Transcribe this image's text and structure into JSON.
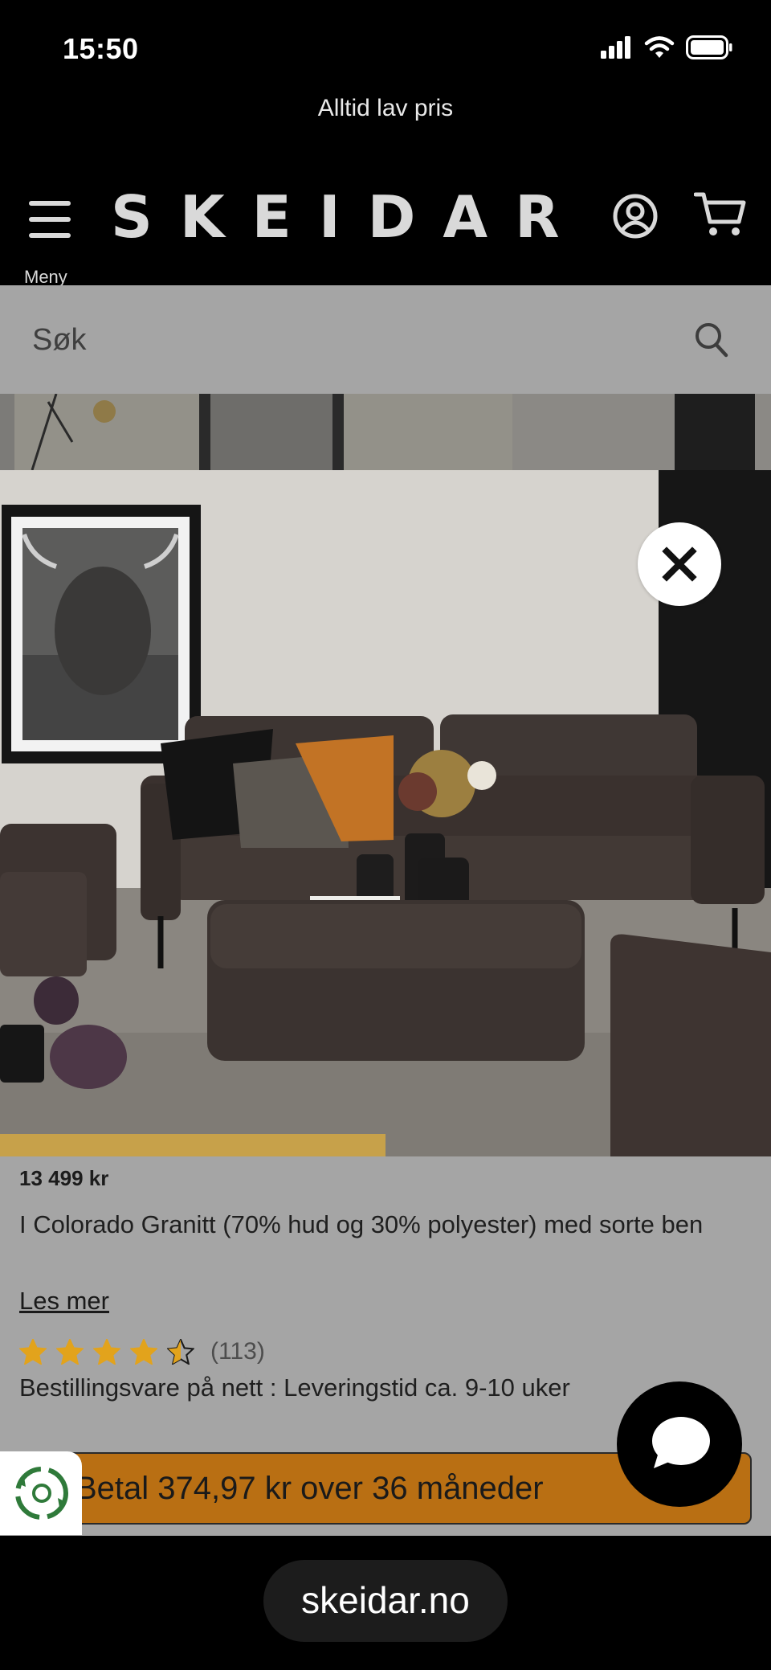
{
  "status": {
    "time": "15:50"
  },
  "promo": {
    "text": "Alltid lav pris"
  },
  "header": {
    "brand": "SKEIDAR",
    "menu_label": "Meny"
  },
  "search": {
    "placeholder": "Søk"
  },
  "product": {
    "price": "13 499 kr",
    "description": "I Colorado Granitt (70% hud og 30% polyester) med sorte ben",
    "read_more": "Les mer",
    "rating": {
      "stars": 4.5,
      "max": 5,
      "count": "(113)"
    },
    "delivery": "Bestillingsvare på nett : Leveringstid ca. 9-10 uker",
    "financing": "Betal 374,97 kr over 36 måneder"
  },
  "browser": {
    "url": "skeidar.no"
  },
  "colors": {
    "accent": "#b96f13",
    "star": "#e2a31c",
    "overlay": "#a5a5a5"
  }
}
